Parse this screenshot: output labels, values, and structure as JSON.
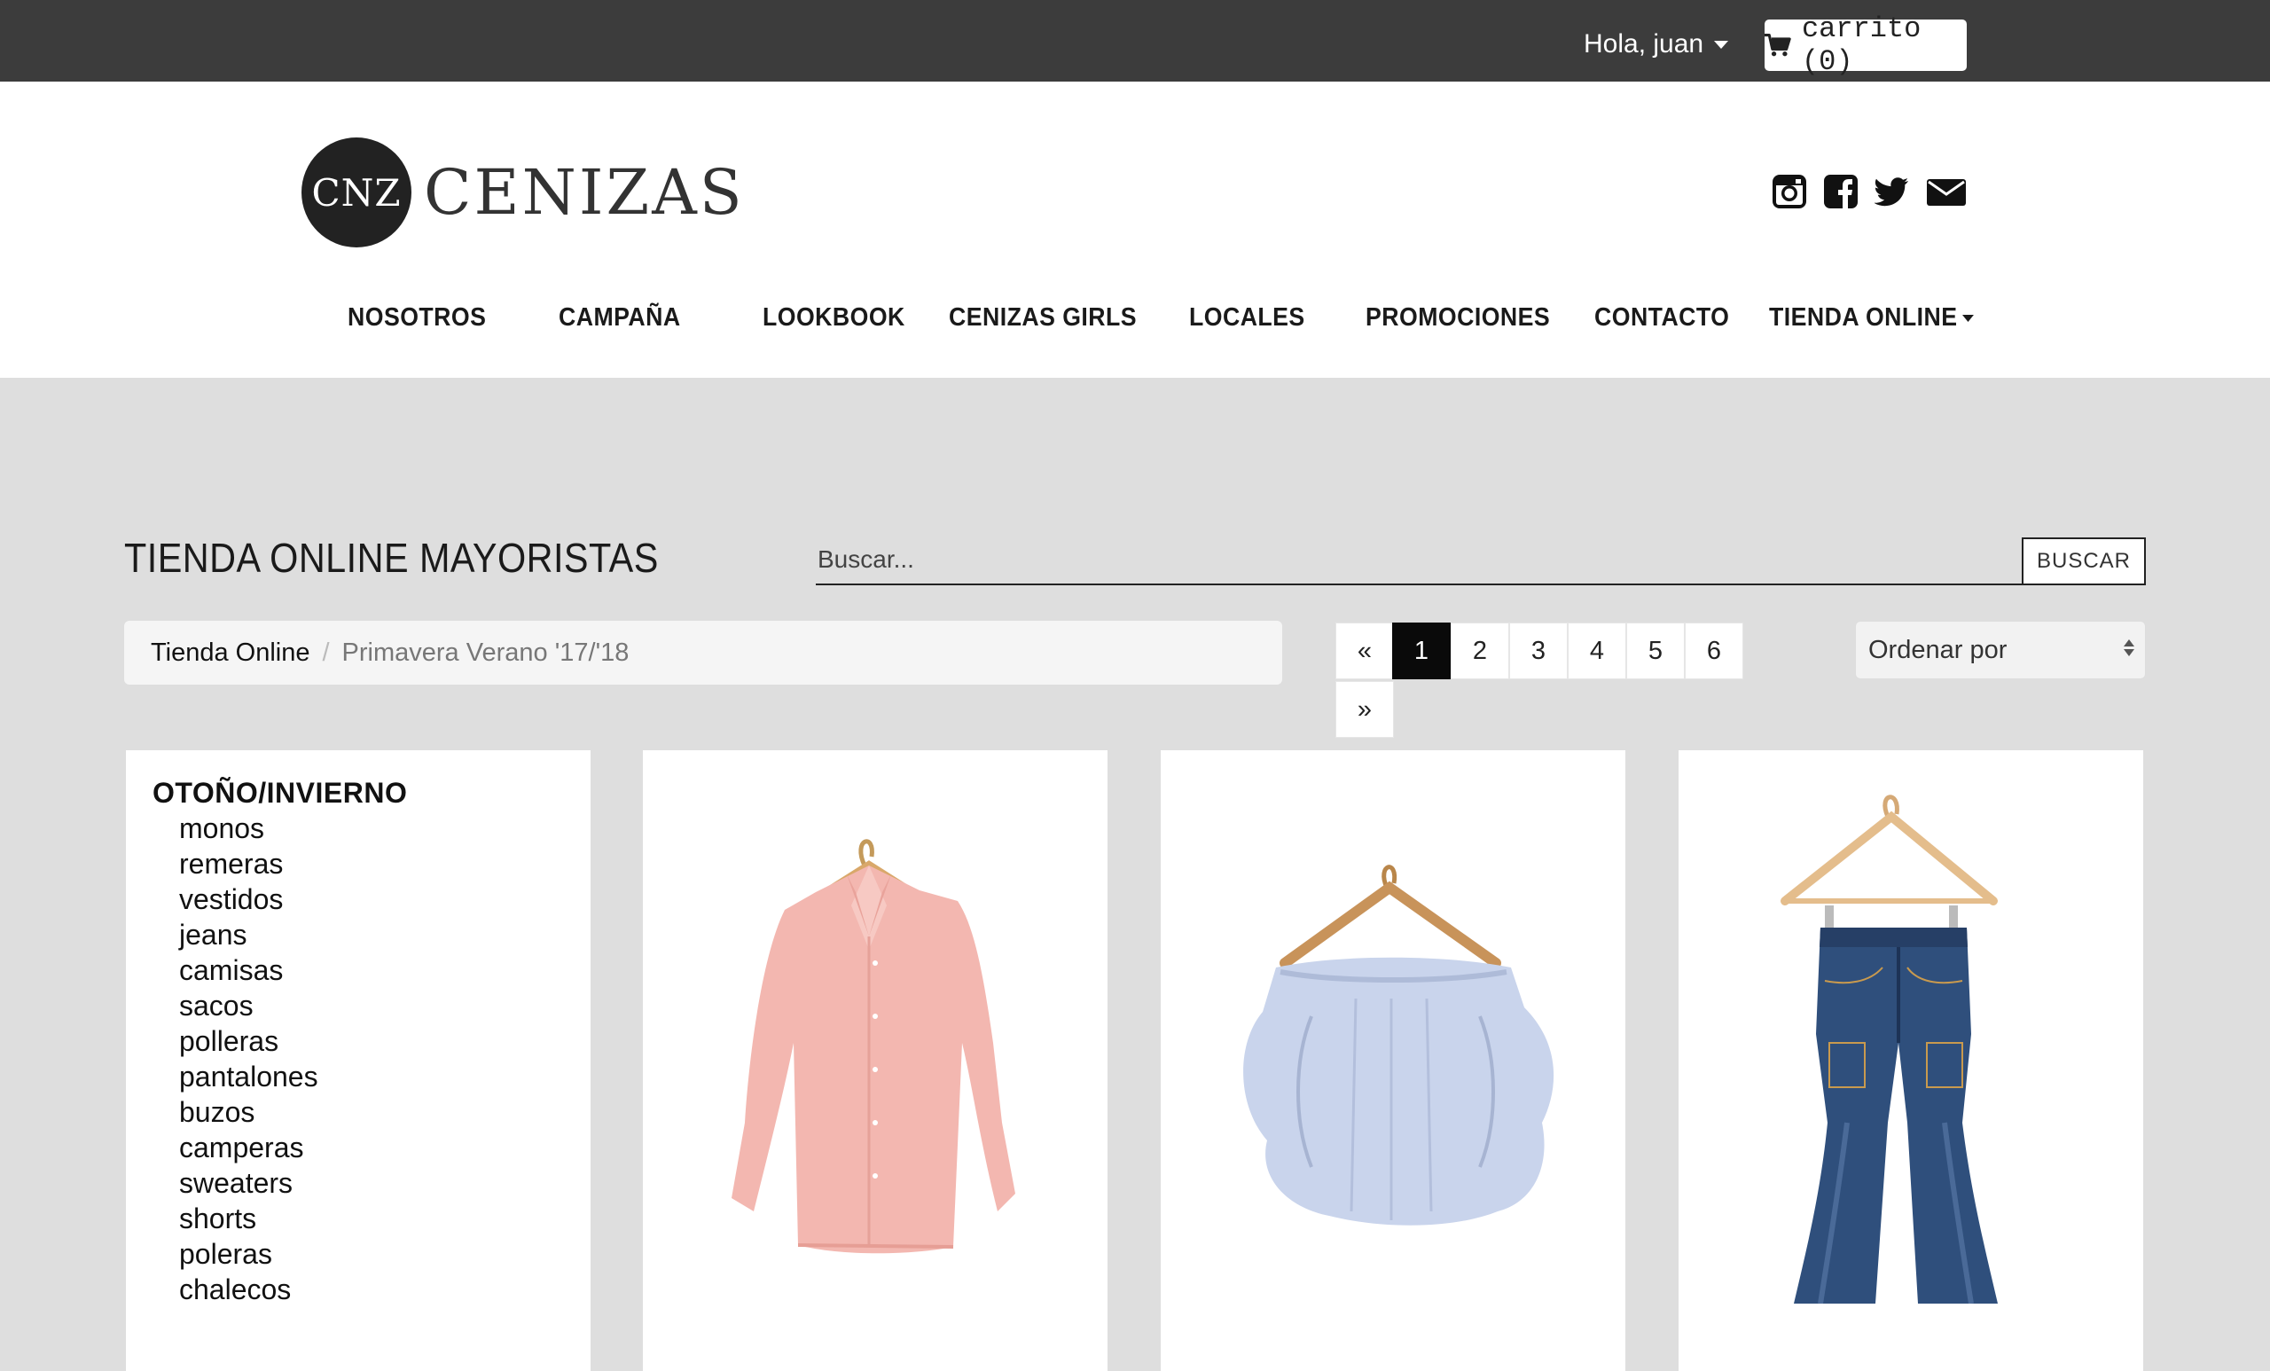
{
  "topbar": {
    "greeting": "Hola, juan",
    "cart_label": "carrito (0)"
  },
  "brand": {
    "mark": "CNZ",
    "name": "CENIZAS"
  },
  "social": [
    "instagram-icon",
    "facebook-icon",
    "twitter-icon",
    "envelope-icon"
  ],
  "nav": {
    "items": [
      "NOSOTROS",
      "CAMPAÑA",
      "LOOKBOOK",
      "CENIZAS GIRLS",
      "LOCALES",
      "PROMOCIONES",
      "CONTACTO",
      "TIENDA ONLINE"
    ]
  },
  "main": {
    "title": "TIENDA ONLINE MAYORISTAS",
    "search_placeholder": "Buscar...",
    "search_button": "BUSCAR",
    "breadcrumb": {
      "home": "Tienda Online",
      "current": "Primavera Verano '17/'18"
    },
    "pagination": {
      "prev": "«",
      "pages": [
        "1",
        "2",
        "3",
        "4",
        "5",
        "6"
      ],
      "next": "»",
      "current": "1"
    },
    "sort_label": "Ordenar por"
  },
  "sidebar": {
    "category": "OTOÑO/INVIERNO",
    "items": [
      "monos",
      "remeras",
      "vestidos",
      "jeans",
      "camisas",
      "sacos",
      "polleras",
      "pantalones",
      "buzos",
      "camperas",
      "sweaters",
      "shorts",
      "poleras",
      "chalecos"
    ]
  },
  "products": [
    {
      "image": "pink-shirt-on-hanger"
    },
    {
      "image": "off-shoulder-striped-blouse-on-hanger"
    },
    {
      "image": "flared-blue-jeans-on-hanger"
    }
  ],
  "colors": {
    "topbar": "#3c3c3c",
    "background": "#dedede",
    "active_page": "#0a0a0a"
  }
}
